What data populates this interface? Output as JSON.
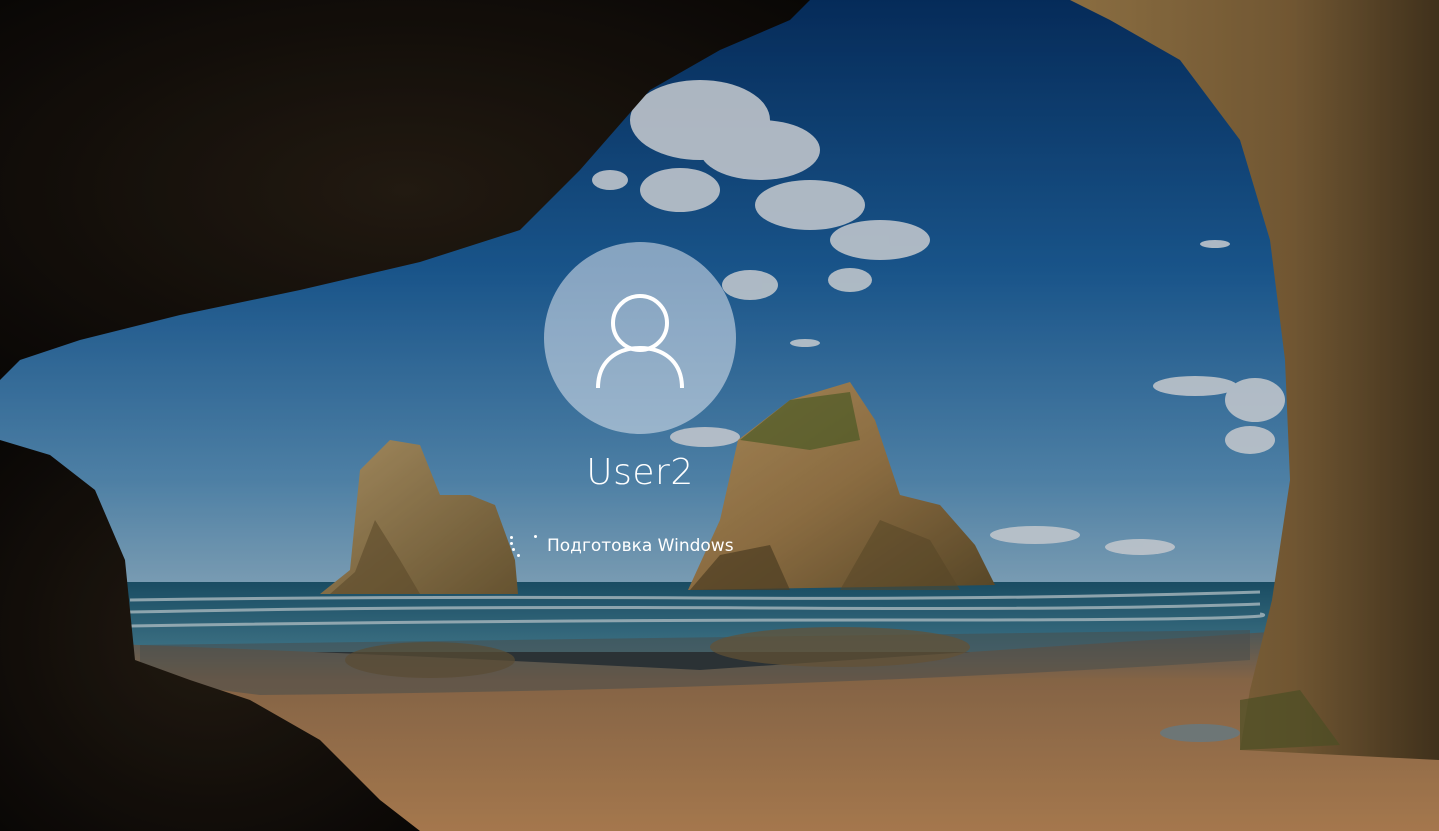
{
  "lock_screen": {
    "user_icon": "user-silhouette-icon",
    "username": "User2",
    "status_text": "Подготовка Windows",
    "spinner_icon": "loading-spinner-icon"
  },
  "colors": {
    "sky_top": "#0c4a8a",
    "sky_horizon": "#8ab6d6",
    "sea": "#2c6e86",
    "sand": "#b8875a",
    "rock": "#9b7a45",
    "cave": "#1c150e",
    "avatar_circle": "#e1e8f0",
    "text": "#ffffff"
  }
}
